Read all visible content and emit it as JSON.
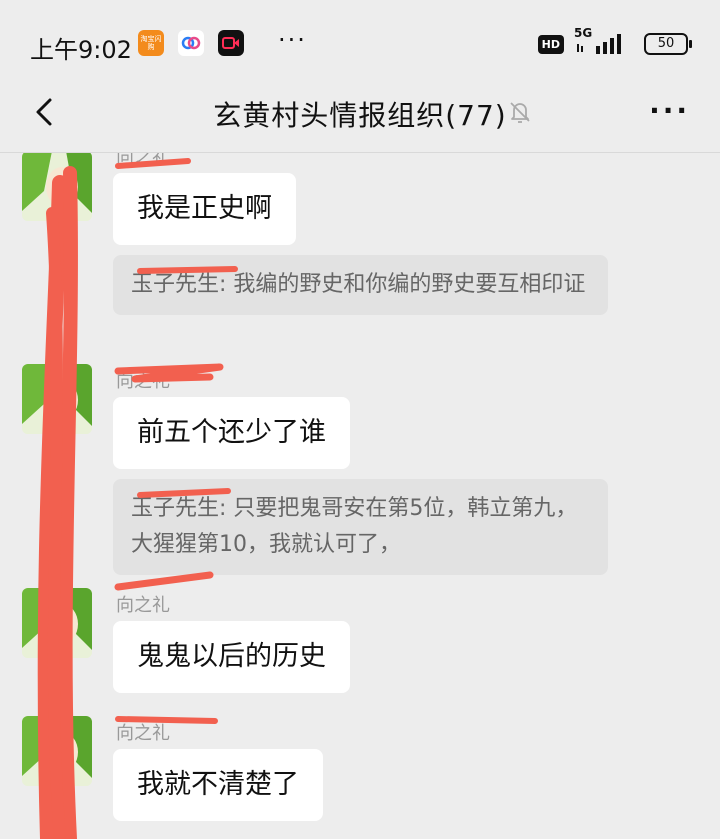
{
  "status_bar": {
    "time": "上午9:02",
    "app_icon_taobao": "淘宝闪购",
    "dots": "···",
    "hd": "HD",
    "network": "5G",
    "battery": "50"
  },
  "header": {
    "title": "玄黄村头情报组织(77)",
    "more_label": "···"
  },
  "messages": [
    {
      "sender": "向之礼",
      "text": "我是正史啊",
      "quote": "玉子先生: 我编的野史和你编的野史要互相印证"
    },
    {
      "sender": "向之礼",
      "text": "前五个还少了谁",
      "quote": "玉子先生: 只要把鬼哥安在第5位，韩立第九，大猩猩第10，我就认可了，"
    },
    {
      "sender": "向之礼",
      "text": "鬼鬼以后的历史"
    },
    {
      "sender": "向之礼",
      "text": "我就不清楚了"
    }
  ],
  "colors": {
    "background": "#ededed",
    "bubble": "#ffffff",
    "quote": "#e2e2e2",
    "redaction": "#f2604f"
  }
}
